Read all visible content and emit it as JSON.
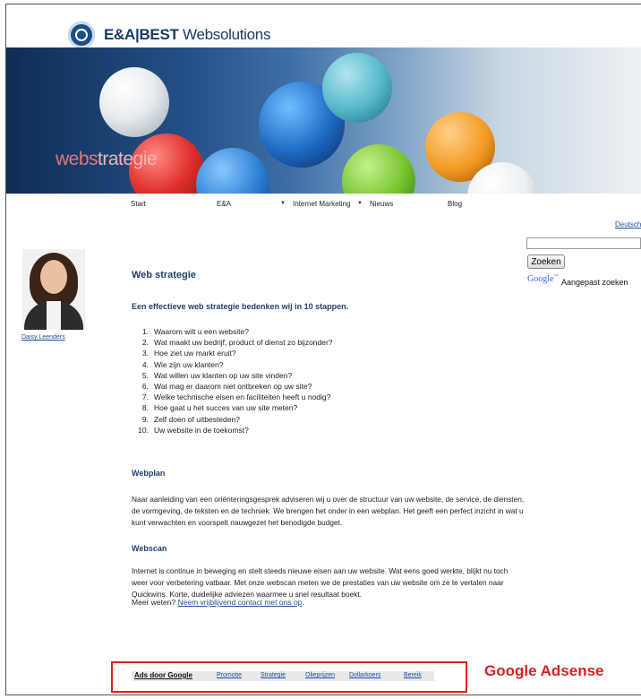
{
  "header": {
    "brand_bold": "E&A|BEST",
    "brand_light": " Websolutions"
  },
  "banner": {
    "title_a": "webs",
    "title_b": "trategie"
  },
  "nav": {
    "items": [
      "Start",
      "E&A",
      "Internet Marketing",
      "Nieuws",
      "Blog"
    ],
    "language_link": "Deutsch"
  },
  "sidebar": {
    "person_name": "Daisy Leenders"
  },
  "search": {
    "button_label": "Zoeken",
    "google_logo": "Google",
    "custom_label": "Aangepast zoeken"
  },
  "content": {
    "title": "Web strategie",
    "lead": "Een effectieve web strategie bedenken wij in 10 stappen.",
    "steps": [
      "Waarom wilt u een website?",
      "Wat maakt uw bedrijf, product of dienst zo bijzonder?",
      "Hoe ziet uw markt eruit?",
      "Wie zijn uw klanten?",
      "Wat willen uw klanten op uw site vinden?",
      "Wat mag er daarom niet ontbreken op uw site?",
      "Welke technische eisen en faciliteiten heeft u nodig?",
      "Hoe gaat u het succes van uw site meten?",
      "Zelf doen of uitbesteden?",
      "Uw website in de toekomst?"
    ],
    "webplan_title": "Webplan",
    "webplan_text": "Naar aanleiding van een oriënteringsgesprek adviseren wij u over de structuur van uw website, de service, de diensten, de vormgeving, de teksten en de techniek. We brengen het onder in een webplan. Het geeft een perfect inzicht in wat u kunt verwachten en voorspelt nauwgezet het benodigde budget.",
    "webscan_title": "Webscan",
    "webscan_text": "Internet is continue in beweging en stelt steeds nieuwe eisen aan uw website. Wat eens goed werkte, blijkt nu toch weer voor verbetering vatbaar. Met onze webscan meten we de prestaties van uw website om ze te vertalen naar Quickwins. Korte, duidelijke adviezen waarmee u snel resultaat boekt.",
    "more_prefix": "Meer weten? ",
    "more_link": "Neem vrijblijvend contact met ons op"
  },
  "ads": {
    "label": "Ads door Google",
    "links": [
      "Promotie",
      "Strategie",
      "Olieprijzen",
      "Dollarkoers",
      "Bereik"
    ],
    "annotation": "Google Adsense"
  },
  "colors": {
    "heading_blue": "#1f3f6e",
    "link_blue": "#1a4fa0",
    "annotation_red": "#e01e1e"
  }
}
